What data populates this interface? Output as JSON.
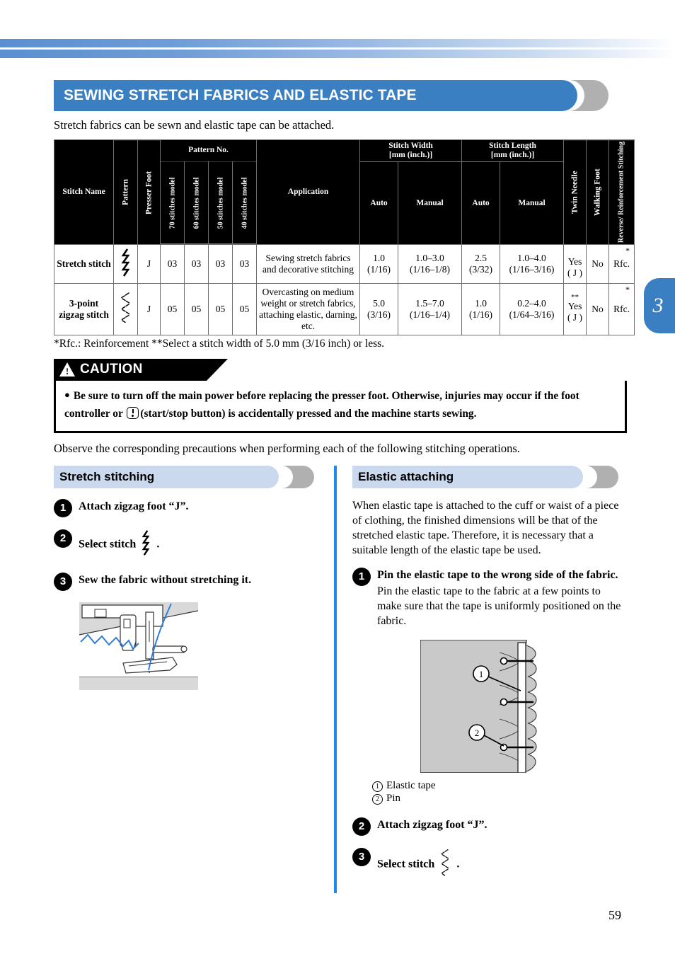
{
  "chapter_tab": "3",
  "page_number": "59",
  "title": "SEWING STRETCH FABRICS AND ELASTIC TAPE",
  "intro": "Stretch fabrics can be sewn and elastic tape can be attached.",
  "table": {
    "headers": {
      "stitch_name": "Stitch Name",
      "pattern": "Pattern",
      "presser_foot": "Presser Foot",
      "pattern_no": "Pattern No.",
      "models": [
        "70 stitches model",
        "60 stitches model",
        "50 stitches model",
        "40 stitches model"
      ],
      "application": "Application",
      "stitch_width": "Stitch Width",
      "stitch_width_unit": "[mm (inch.)]",
      "stitch_length": "Stitch Length",
      "stitch_length_unit": "[mm (inch.)]",
      "auto": "Auto",
      "manual": "Manual",
      "twin_needle": "Twin Needle",
      "walking_foot": "Walking Foot",
      "reverse_reinforcement": "Reverse/ Reinforcement Stitching"
    },
    "rows": [
      {
        "name": "Stretch stitch",
        "pattern_icon": "stretch-stitch-glyph",
        "presser_foot": "J",
        "pattern_no": [
          "03",
          "03",
          "03",
          "03"
        ],
        "application": "Sewing stretch fabrics and decorative stitching",
        "width_auto": "1.0",
        "width_auto_inch": "(1/16)",
        "width_manual": "1.0–3.0",
        "width_manual_inch": "(1/16–1/8)",
        "length_auto": "2.5",
        "length_auto_inch": "(3/32)",
        "length_manual": "1.0–4.0",
        "length_manual_inch": "(1/16–3/16)",
        "twin_needle": "Yes",
        "twin_needle_foot": "( J )",
        "twin_needle_mark": "",
        "walking_foot": "No",
        "reverse": "Rfc.",
        "reverse_mark": "*"
      },
      {
        "name": "3-point zigzag stitch",
        "pattern_icon": "zigzag-3point-glyph",
        "presser_foot": "J",
        "pattern_no": [
          "05",
          "05",
          "05",
          "05"
        ],
        "application": "Overcasting on medium weight or stretch fabrics, attaching elastic, darning, etc.",
        "width_auto": "5.0",
        "width_auto_inch": "(3/16)",
        "width_manual": "1.5–7.0",
        "width_manual_inch": "(1/16–1/4)",
        "length_auto": "1.0",
        "length_auto_inch": "(1/16)",
        "length_manual": "0.2–4.0",
        "length_manual_inch": "(1/64–3/16)",
        "twin_needle": "Yes",
        "twin_needle_foot": "( J )",
        "twin_needle_mark": "**",
        "walking_foot": "No",
        "reverse": "Rfc.",
        "reverse_mark": "*"
      }
    ]
  },
  "footnote": "*Rfc.: Reinforcement    **Select a stitch width of 5.0 mm (3/16 inch) or less.",
  "caution": {
    "label": "CAUTION",
    "text_1": "Be sure to turn off the main power before replacing the presser foot. Otherwise, injuries may occur if the foot controller or",
    "text_2": "(start/stop button) is accidentally pressed and the machine starts sewing."
  },
  "observe": "Observe the corresponding precautions when performing each of the following stitching operations.",
  "left_column": {
    "heading": "Stretch stitching",
    "steps": [
      {
        "num": "1",
        "text": "Attach zigzag foot “J”."
      },
      {
        "num": "2",
        "text": "Select stitch",
        "text_after": "."
      },
      {
        "num": "3",
        "text": "Sew the fabric without stretching it."
      }
    ]
  },
  "right_column": {
    "heading": "Elastic attaching",
    "intro": "When elastic tape is attached to the cuff or waist of a piece of clothing, the finished dimensions will be that of the stretched elastic tape. Therefore, it is necessary that a suitable length of the elastic tape be used.",
    "steps": [
      {
        "num": "1",
        "text": "Pin the elastic tape to the wrong side of the fabric.",
        "sub": "Pin the elastic tape to the fabric at a few points to make sure that the tape is uniformly positioned on the fabric."
      },
      {
        "num": "2",
        "text": "Attach zigzag foot “J”."
      },
      {
        "num": "3",
        "text": "Select stitch",
        "text_after": "."
      }
    ],
    "legend": [
      {
        "num": "1",
        "label": "Elastic tape"
      },
      {
        "num": "2",
        "label": "Pin"
      }
    ]
  },
  "colors": {
    "accent_blue": "#3a7fc2",
    "light_blue": "#cbd9ee",
    "divider_blue": "#1a8cf0",
    "gray": "#b3b3b3"
  }
}
